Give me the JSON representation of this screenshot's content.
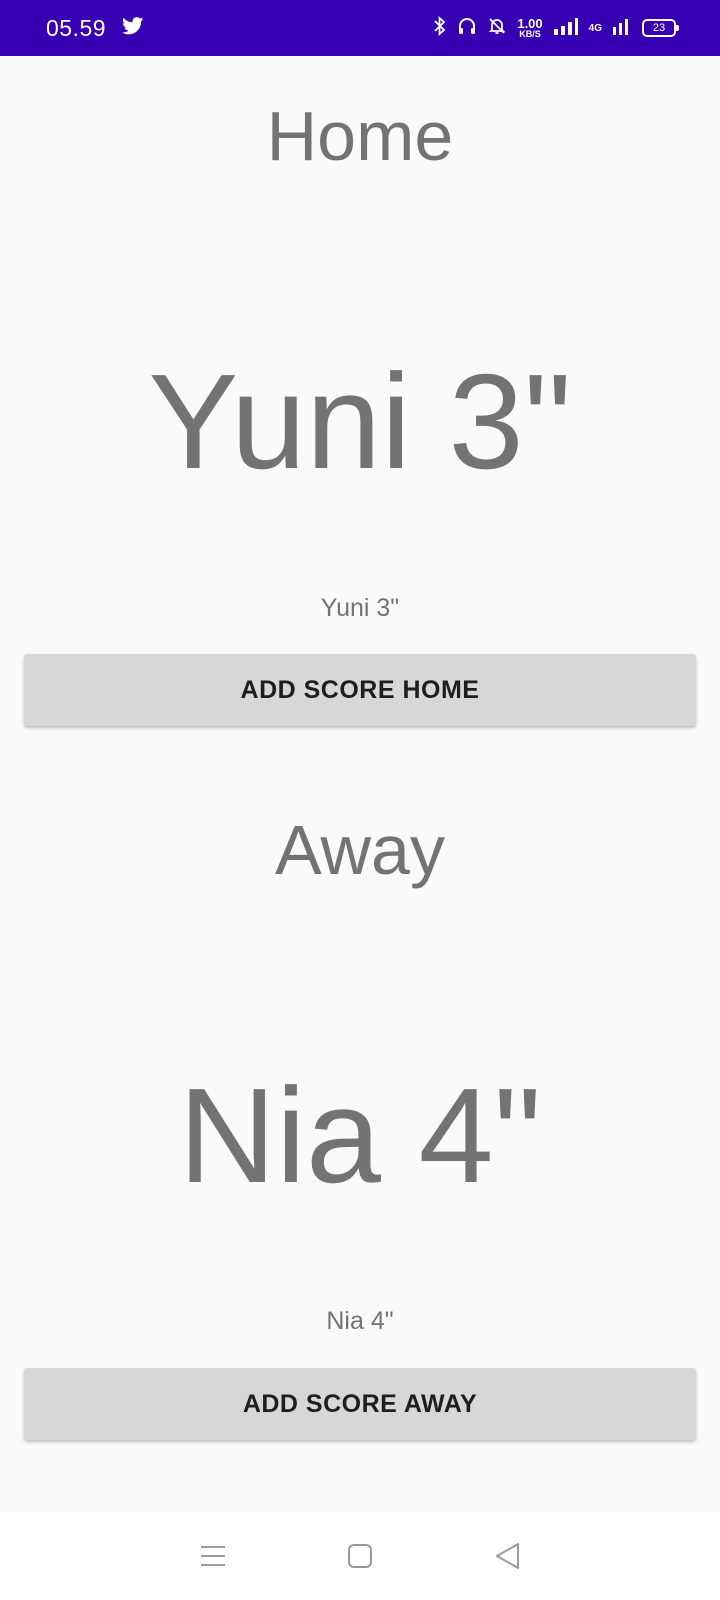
{
  "status_bar": {
    "time": "05.59",
    "notification_icon": "twitter-icon",
    "net_speed_value": "1.00",
    "net_speed_unit": "KB/S",
    "network_type": "4G",
    "battery_level": "23",
    "icons": [
      "bluetooth-icon",
      "headphones-icon",
      "bell-off-icon",
      "signal-icon",
      "signal-4g-icon",
      "battery-icon"
    ],
    "background_color": "#3700b3"
  },
  "home": {
    "label": "Home",
    "score_big": "Yuni 3\"",
    "score_small": "Yuni 3\"",
    "button_label": "ADD SCORE HOME"
  },
  "away": {
    "label": "Away",
    "score_big": "Nia 4\"",
    "score_small": "Nia 4\"",
    "button_label": "ADD SCORE AWAY"
  },
  "nav_bar": {
    "buttons": [
      "menu-icon",
      "home-square-icon",
      "back-triangle-icon"
    ]
  },
  "colors": {
    "text_gray": "#737373",
    "button_bg": "#d6d7d7",
    "page_bg": "#fafafa"
  }
}
